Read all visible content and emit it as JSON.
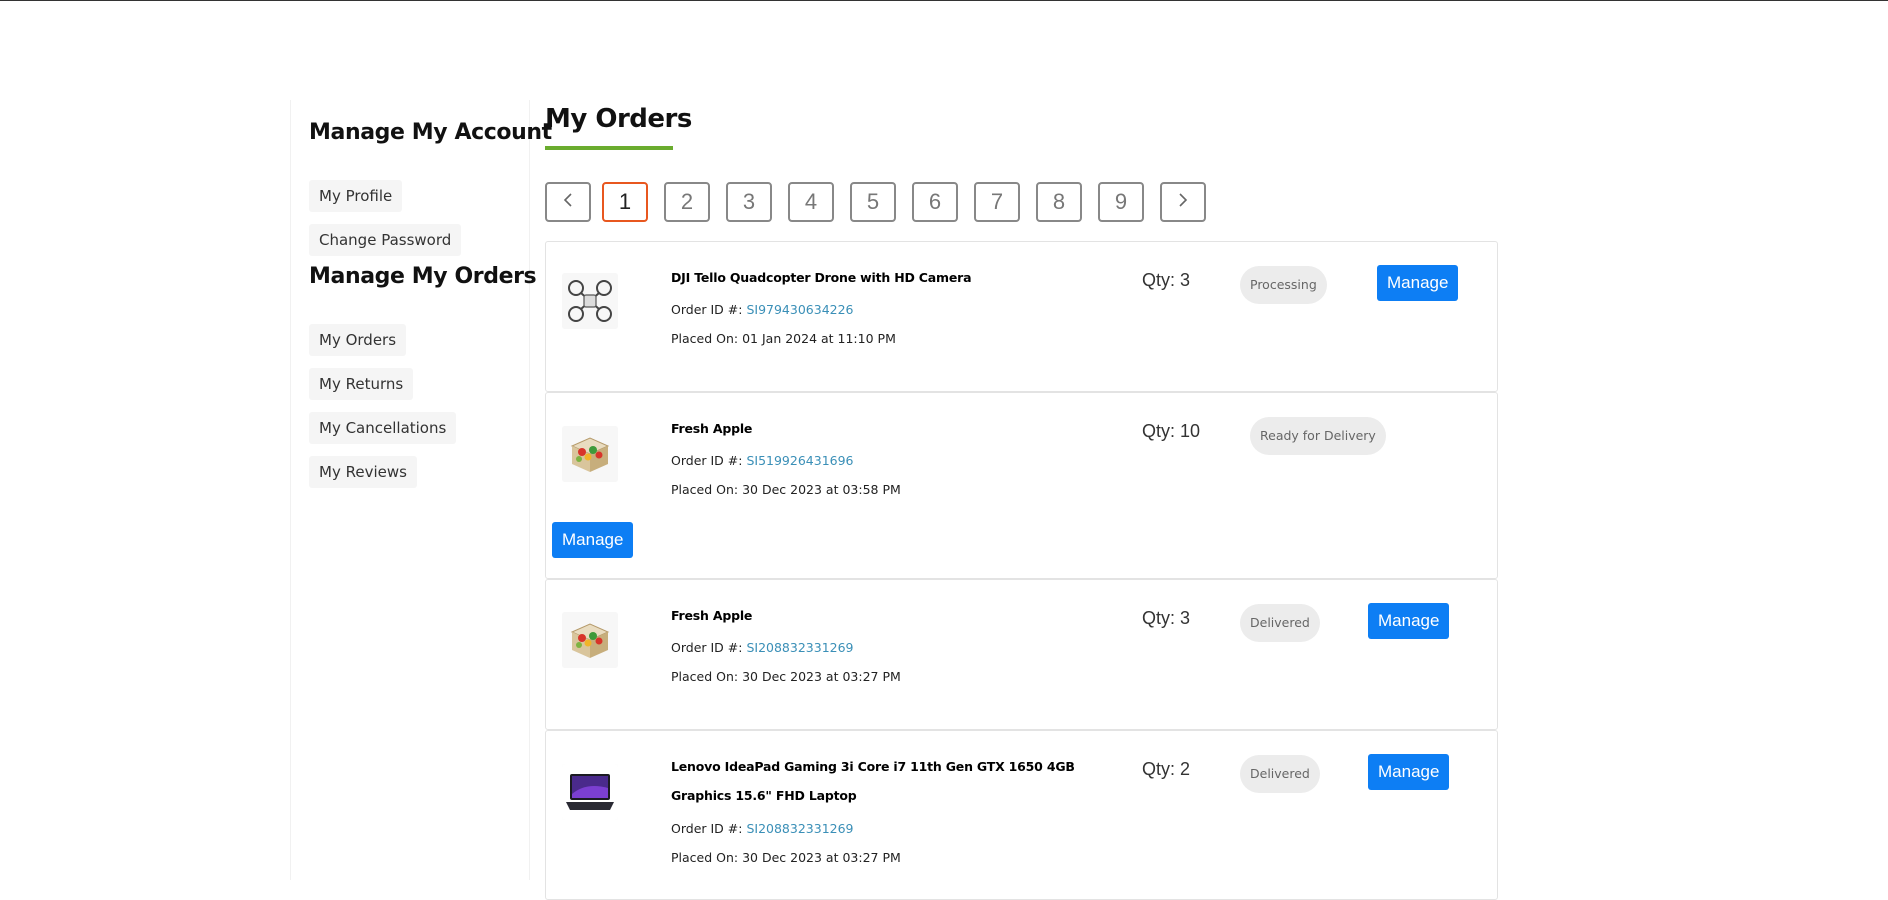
{
  "sidebar": {
    "account_heading": "Manage My Account",
    "account_links": [
      "My Profile",
      "Change Password"
    ],
    "orders_heading": "Manage My Orders",
    "orders_links": [
      "My Orders",
      "My Returns",
      "My Cancellations",
      "My Reviews"
    ]
  },
  "main": {
    "title": "My Orders",
    "accent_color": "#6aac2e"
  },
  "pagination": {
    "prev_icon": "chevron-left-icon",
    "next_icon": "chevron-right-icon",
    "pages": [
      "1",
      "2",
      "3",
      "4",
      "5",
      "6",
      "7",
      "8",
      "9"
    ],
    "active_page": "1",
    "active_color": "#e8571f"
  },
  "orders": [
    {
      "product": "DJI Tello Quadcopter Drone with HD Camera",
      "order_id_label": "Order ID #: ",
      "order_id": "SI979430634226",
      "placed_on": "Placed On: 01 Jan 2024 at 11:10 PM",
      "qty": "Qty: 3",
      "status": "Processing",
      "manage_label": "Manage",
      "thumb_icon": "drone-icon"
    },
    {
      "product": "Fresh Apple",
      "order_id_label": "Order ID #: ",
      "order_id": "SI519926431696",
      "placed_on": "Placed On: 30 Dec 2023 at 03:58 PM",
      "qty": "Qty: 10",
      "status": "Ready for Delivery",
      "manage_label": "Manage",
      "thumb_icon": "food-box-icon"
    },
    {
      "product": "Fresh Apple",
      "order_id_label": "Order ID #: ",
      "order_id": "SI208832331269",
      "placed_on": "Placed On: 30 Dec 2023 at 03:27 PM",
      "qty": "Qty: 3",
      "status": "Delivered",
      "manage_label": "Manage",
      "thumb_icon": "food-box-icon"
    },
    {
      "product": "Lenovo IdeaPad Gaming 3i Core i7 11th Gen GTX 1650 4GB Graphics 15.6\" FHD Laptop",
      "order_id_label": "Order ID #: ",
      "order_id": "SI208832331269",
      "placed_on": "Placed On: 30 Dec 2023 at 03:27 PM",
      "qty": "Qty: 2",
      "status": "Delivered",
      "manage_label": "Manage",
      "thumb_icon": "laptop-icon"
    }
  ],
  "colors": {
    "manage_button": "#0d7ef4",
    "order_id_link": "#3a8fb7",
    "status_pill": "#ececec"
  }
}
